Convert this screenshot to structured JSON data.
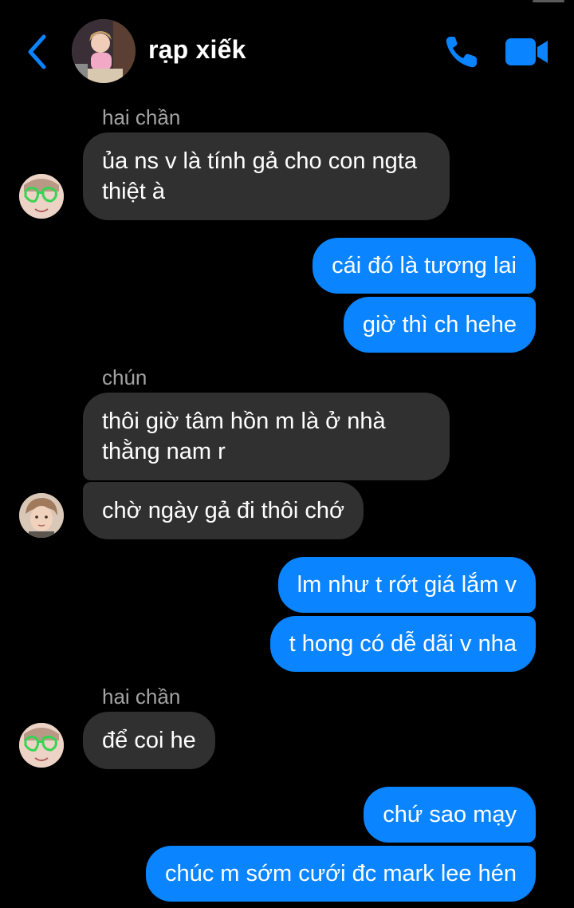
{
  "header": {
    "title": "rạp xiếk",
    "back_icon": "chevron-left-icon",
    "call_icon": "phone-icon",
    "video_icon": "video-camera-icon",
    "accent_color": "#0a84ff"
  },
  "thread": {
    "groups": [
      {
        "sender": "hai chần",
        "messages": [
          "ủa ns v là tính gả cho con ngta\nthiệt à"
        ]
      },
      {
        "outgoing": [
          "cái đó là tương lai",
          "giờ thì ch hehe"
        ]
      },
      {
        "sender": "chún",
        "messages": [
          "thôi giờ tâm hồn m là ở nhà\nthằng nam r",
          "chờ ngày gả đi thôi chớ"
        ]
      },
      {
        "outgoing": [
          "lm như t rớt giá lắm v",
          "t hong có dễ dãi v nha"
        ]
      },
      {
        "sender": "hai chần",
        "messages": [
          "để coi he"
        ]
      },
      {
        "outgoing": [
          "chứ sao mạy",
          "chúc m sớm cưới đc mark lee hén"
        ]
      }
    ]
  },
  "colors": {
    "background": "#000000",
    "incoming_bubble": "#303030",
    "outgoing_bubble": "#0a84ff",
    "sender_name": "#a4a4a4"
  }
}
